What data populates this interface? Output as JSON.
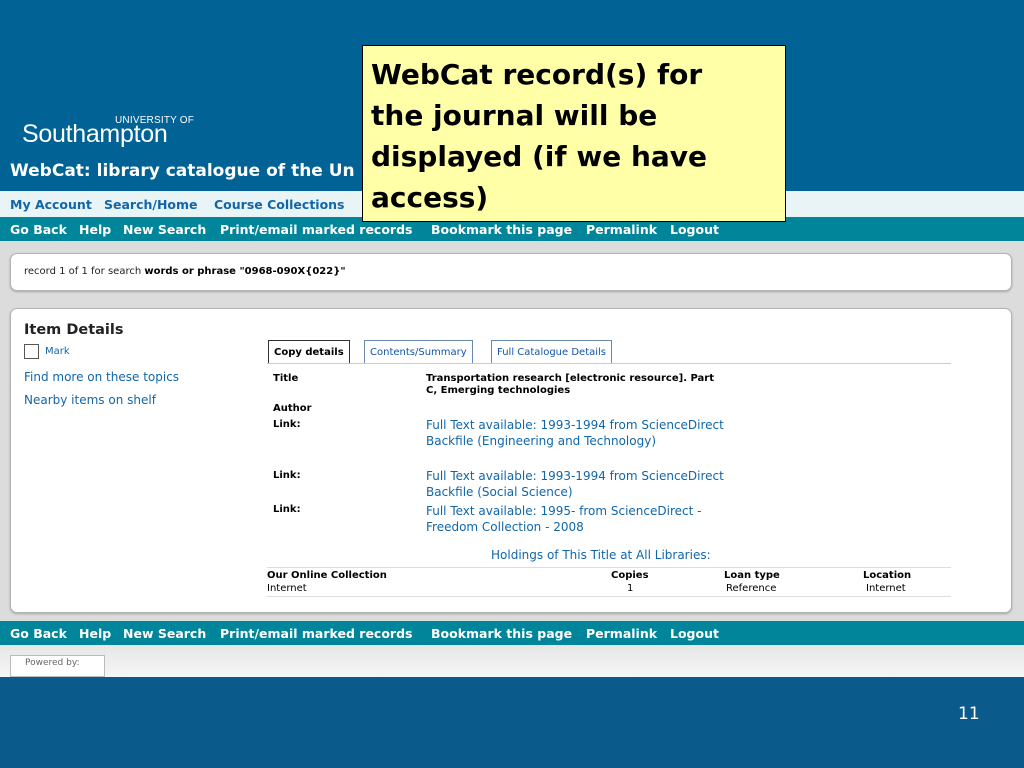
{
  "logo": {
    "sup": "UNIVERSITY OF",
    "main": "Southampton"
  },
  "site_title": "WebCat: library catalogue of the Un",
  "nav_top": [
    "My Account",
    "Search/Home",
    "Course Collections"
  ],
  "nav_main": [
    "Go Back",
    "Help",
    "New Search",
    "Print/email marked records",
    "Bookmark this page",
    "Permalink",
    "Logout"
  ],
  "record": {
    "prefix": "record 1 of 1 for search ",
    "query": "words or phrase \"0968-090X{022}\""
  },
  "item": {
    "title": "Item Details",
    "mark_label": "Mark",
    "side_links": [
      "Find more on these topics",
      "Nearby items on shelf"
    ],
    "tabs": [
      "Copy details",
      "Contents/Summary",
      "Full Catalogue Details"
    ],
    "fields": {
      "title_label": "Title",
      "title_value": "Transportation research [electronic resource]. Part C, Emerging technologies",
      "author_label": "Author",
      "link_label": "Link:",
      "links": [
        "Full Text available: 1993-1994 from ScienceDirect Backfile (Engineering and Technology)",
        "Full Text available: 1993-1994 from ScienceDirect Backfile (Social Science)",
        "Full Text available: 1995- from ScienceDirect - Freedom Collection - 2008"
      ]
    },
    "holdings_title": "Holdings of This Title at All Libraries:",
    "holdings_headers": [
      "Our Online Collection",
      "Copies",
      "Loan type",
      "Location"
    ],
    "holdings_row": [
      "Internet",
      "1",
      "Reference",
      "Internet"
    ]
  },
  "footer": {
    "powered": "Powered by:"
  },
  "callout": "WebCat record(s) for\nthe journal will be\ndisplayed (if we have\naccess)",
  "slide_number": "11",
  "colors": {
    "slide_bg": "#0b5a8c",
    "nav_teal": "#00859a",
    "link_blue": "#1166aa",
    "callout_bg": "#ffffa8"
  }
}
